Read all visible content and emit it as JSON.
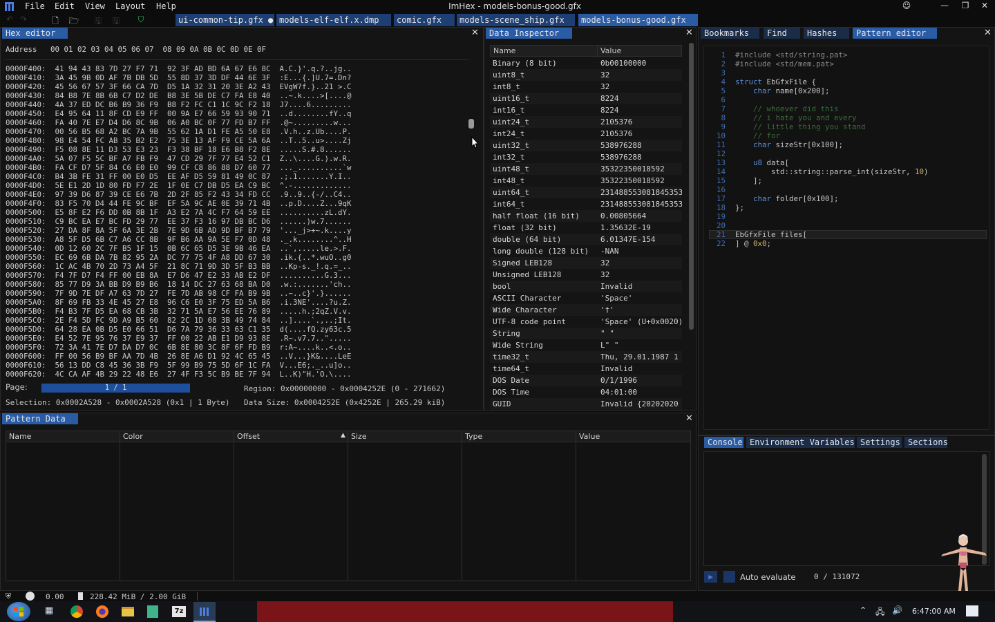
{
  "window": {
    "title": "ImHex - models-bonus-good.gfx",
    "menu": [
      "File",
      "Edit",
      "View",
      "Layout",
      "Help"
    ]
  },
  "file_tabs": [
    {
      "label": "ui-common-tip.gfx ●",
      "active": false
    },
    {
      "label": "models-elf-elf.x.dmp",
      "active": false
    },
    {
      "label": "comic.gfx",
      "active": false
    },
    {
      "label": "models-scene_ship.gfx",
      "active": false
    },
    {
      "label": "models-bonus-good.gfx",
      "active": true
    }
  ],
  "hex_editor": {
    "tab_label": "Hex editor",
    "header": "Address   00 01 02 03 04 05 06 07  08 09 0A 0B 0C 0D 0E 0F",
    "rows": [
      "0000F400:  41 94 43 83 7D 27 F7 71  92 3F AD BD 6A 67 E6 8C  A.C.}'.q.?..jg..",
      "0000F410:  3A 45 9B 0D AF 7B DB 5D  55 8D 37 3D DF 44 6E 3F  :E...{.]U.7=.Dn?",
      "0000F420:  45 56 67 57 3F 66 CA 7D  D5 1A 32 31 20 3E A2 43  EVgW?f.}..21 >.C",
      "0000F430:  84 B8 7E 8B 6B C7 D2 DE  B8 3E 5B DE C7 FA E8 40  ..~.k....>[....@",
      "0000F440:  4A 37 ED DC B6 B9 36 F9  B8 F2 FC C1 1C 9C F2 18  J7....6.........",
      "0000F450:  E4 95 64 11 8F CD E9 FF  00 9A E7 66 59 93 90 71  ..d........fY..q",
      "0000F460:  FA 40 7E E7 D4 D6 8C 9B  06 A0 BC 0F 77 FD B7 FF  .@~.........w...",
      "0000F470:  00 56 B5 68 A2 BC 7A 9B  55 62 1A D1 FE A5 50 E8  .V.h..z.Ub....P.",
      "0000F480:  98 E4 54 FC AB 35 B2 E2  75 3E 13 AF F9 CE 5A 6A  ..T..5..u>....Zj",
      "0000F490:  F5 08 8E 11 D3 53 E3 23  F3 38 BF 18 E6 B8 F2 8E  .....S.#.8......",
      "0000F4A0:  5A 07 F5 5C BF A7 FB F9  47 CD 29 7F 77 E4 52 C1  Z..\\....G.).w.R.",
      "0000F4B0:  FA CF D7 5F 84 C6 E0 E0  99 CF C8 86 88 D7 60 77  ..._..........`w",
      "0000F4C0:  B4 3B FE 31 FF 00 E0 D5  EE AF D5 59 81 49 0C 87  .;.1.......Y.I..",
      "0000F4D0:  5E E1 2D 1D 80 FD F7 2E  1F 0E C7 DB D5 EA C9 BC  ^.-.............",
      "0000F4E0:  97 39 D6 87 39 CE E6 7B  2D 2F 85 F2 43 34 FD CC  .9..9..{-/..C4..",
      "0000F4F0:  83 F5 70 D4 44 FE 9C BF  EF 5A 9C AE 0E 39 71 4B  ..p.D....Z...9qK",
      "0000F500:  E5 8F E2 F6 DD 0B 8B 1F  A3 E2 7A 4C F7 64 59 EE  ..........zL.dY.",
      "0000F510:  C9 BC EA E7 BC FD 29 77  EE 37 F3 16 97 DB BC D6  ......)w.7......",
      "0000F520:  27 DA 8F 8A 5F 6A 3E 2B  7E 9D 6B AD 9D BF B7 79  '..._j>+~.k....y",
      "0000F530:  A8 5F D5 6B C7 A6 CC 8B  9F B6 AA 9A 5E F7 0D 48  ._.k........^..H",
      "0000F540:  0D 12 60 2C 7F B5 1F 15  0B 6C 65 D5 3E 9B 46 EA  ..`,.....le.>.F.",
      "0000F550:  EC 69 6B DA 7B 82 95 2A  DC 77 75 4F A8 DD 67 30  .ik.{..*.wuO..g0",
      "0000F560:  1C AC 4B 70 2D 73 A4 5F  21 8C 71 9D 3D 5F B3 BB  ..Kp-s._!.q.=_..",
      "0000F570:  F4 7F D7 F4 FF 00 EB 8A  E7 D6 47 E2 33 AB E2 DF  ..........G.3...",
      "0000F580:  85 77 D9 3A BB D9 B9 B6  18 14 DC 27 63 68 BA D0  .w.:.......'ch..",
      "0000F590:  7F 9D 7E DF A7 63 7D 27  FE 7D AB 98 CF FA B9 9B  ..~..c}'.}......",
      "0000F5A0:  8F 69 FB 33 4E 45 27 E8  96 C6 E0 3F 75 ED 5A B6  .i.3NE'....?u.Z.",
      "0000F5B0:  F4 B3 7F D5 EA 68 CB 3B  32 71 5A E7 56 EE 76 89  .....h.;2qZ.V.v.",
      "0000F5C0:  2E F4 5D FC 9D A9 B5 60  82 2C 1D 08 3B 49 74 84  ..]....`.,..;It.",
      "0000F5D0:  64 28 EA 0B D5 E0 66 51  D6 7A 79 36 33 63 C1 35  d(....fQ.zy63c.5",
      "0000F5E0:  E4 52 7E 95 76 37 E9 37  FF 00 22 AB E1 D9 93 8E  .R~.v7.7..\".....",
      "0000F5F0:  72 3A 41 7E D7 DA D7 0C  6B 8E 80 3C 8F 6F FD B9  r:A~....k..<.o..",
      "0000F600:  FF 00 56 B9 BF AA 7D 4B  26 8E A6 D1 92 4C 65 45  ..V...}K&....LeE",
      "0000F610:  56 13 DD C8 45 36 3B F9  5F 99 B9 75 5D 6F 1C FA  V...E6;._..u]o..",
      "0000F620:  4C CA AF 4B 29 22 48 E6  27 4F F3 5C B9 BE 7F 94  L..K)\"H.'O.\\...."
    ],
    "page_label": "Page:",
    "page_value": "1 / 1",
    "region": "Region: 0x00000000 - 0x0004252E (0 - 271662)",
    "selection": "Selection: 0x0002A528 - 0x0002A528 (0x1 | 1 Byte)",
    "data_size": "Data Size: 0x0004252E (0x4252E | 265.29 kiB)"
  },
  "data_inspector": {
    "tab_label": "Data Inspector",
    "col_name": "Name",
    "col_value": "Value",
    "rows": [
      {
        "name": "Binary (8 bit)",
        "value": "0b00100000"
      },
      {
        "name": "uint8_t",
        "value": "32"
      },
      {
        "name": "int8_t",
        "value": "32"
      },
      {
        "name": "uint16_t",
        "value": "8224"
      },
      {
        "name": "int16_t",
        "value": "8224"
      },
      {
        "name": "uint24_t",
        "value": "2105376"
      },
      {
        "name": "int24_t",
        "value": "2105376"
      },
      {
        "name": "uint32_t",
        "value": "538976288"
      },
      {
        "name": "int32_t",
        "value": "538976288"
      },
      {
        "name": "uint48_t",
        "value": "35322350018592"
      },
      {
        "name": "int48_t",
        "value": "35322350018592"
      },
      {
        "name": "uint64_t",
        "value": "2314885530818453536"
      },
      {
        "name": "int64_t",
        "value": "2314885530818453536"
      },
      {
        "name": "half float (16 bit)",
        "value": "0.00805664"
      },
      {
        "name": "float (32 bit)",
        "value": "1.35632E-19"
      },
      {
        "name": "double (64 bit)",
        "value": "6.01347E-154"
      },
      {
        "name": "long double (128 bit)",
        "value": "-NAN"
      },
      {
        "name": "Signed LEB128",
        "value": "32"
      },
      {
        "name": "Unsigned LEB128",
        "value": "32"
      },
      {
        "name": "bool",
        "value": "Invalid"
      },
      {
        "name": "ASCII Character",
        "value": "'Space'"
      },
      {
        "name": "Wide Character",
        "value": "'†'"
      },
      {
        "name": "UTF-8 code point",
        "value": "'Space' (U+0x0020)"
      },
      {
        "name": "String",
        "value": "\" \""
      },
      {
        "name": "Wide String",
        "value": "L\" \""
      },
      {
        "name": "time32_t",
        "value": "Thu, 29.01.1987 1"
      },
      {
        "name": "time64_t",
        "value": "Invalid"
      },
      {
        "name": "DOS Date",
        "value": "0/1/1996"
      },
      {
        "name": "DOS Time",
        "value": "04:01:00"
      },
      {
        "name": "GUID",
        "value": "Invalid {20202020"
      }
    ]
  },
  "right_tabs": [
    "Bookmarks",
    "Find",
    "Hashes",
    "Pattern editor"
  ],
  "pattern_editor": {
    "lines": [
      [
        {
          "t": "pp",
          "s": "#include <std/string.pat>"
        }
      ],
      [
        {
          "t": "pp",
          "s": "#include <std/mem.pat>"
        }
      ],
      [],
      [
        {
          "t": "kw",
          "s": "struct"
        },
        {
          "t": "tx",
          "s": " EbGfxFile {"
        }
      ],
      [
        {
          "t": "tx",
          "s": "    "
        },
        {
          "t": "kw",
          "s": "char"
        },
        {
          "t": "tx",
          "s": " name[0x200];"
        }
      ],
      [],
      [
        {
          "t": "cm",
          "s": "    // whoever did this"
        }
      ],
      [
        {
          "t": "cm",
          "s": "    // i hate you and every"
        }
      ],
      [
        {
          "t": "cm",
          "s": "    // little thing you stand"
        }
      ],
      [
        {
          "t": "cm",
          "s": "    // for"
        }
      ],
      [
        {
          "t": "tx",
          "s": "    "
        },
        {
          "t": "kw",
          "s": "char"
        },
        {
          "t": "tx",
          "s": " sizeStr[0x100];"
        }
      ],
      [],
      [
        {
          "t": "tx",
          "s": "    "
        },
        {
          "t": "kw",
          "s": "u8"
        },
        {
          "t": "tx",
          "s": " data["
        }
      ],
      [
        {
          "t": "tx",
          "s": "        std::string::parse_int(sizeStr, "
        },
        {
          "t": "num",
          "s": "10"
        },
        {
          "t": "tx",
          "s": ")"
        }
      ],
      [
        {
          "t": "tx",
          "s": "    ];"
        }
      ],
      [],
      [
        {
          "t": "tx",
          "s": "    "
        },
        {
          "t": "kw",
          "s": "char"
        },
        {
          "t": "tx",
          "s": " folder[0x100];"
        }
      ],
      [
        {
          "t": "tx",
          "s": "};"
        }
      ],
      [],
      [],
      [
        {
          "t": "tx",
          "s": "EbGfxFile files["
        }
      ],
      [
        {
          "t": "tx",
          "s": "] @ "
        },
        {
          "t": "num",
          "s": "0x0"
        },
        {
          "t": "tx",
          "s": ";"
        }
      ]
    ]
  },
  "bottom_right_tabs": [
    "Console",
    "Environment Variables",
    "Settings",
    "Sections"
  ],
  "auto_evaluate": {
    "label": "Auto evaluate",
    "counter": "0 / 131072"
  },
  "pattern_data": {
    "tab_label": "Pattern Data",
    "columns": [
      "Name",
      "Color",
      "Offset",
      "Size",
      "Type",
      "Value"
    ]
  },
  "status_bar": {
    "fps": "0.00",
    "memory": "228.42 MiB / 2.00 GiB"
  },
  "taskbar": {
    "clock": "6:47:00 AM"
  },
  "colors": {
    "accent": "#2a5ca6",
    "tab_inactive": "#1e3f73",
    "background": "#141414",
    "line_number": "#3f6fb7",
    "keyword": "#5b8fd8",
    "comment": "#3c6a3c"
  }
}
